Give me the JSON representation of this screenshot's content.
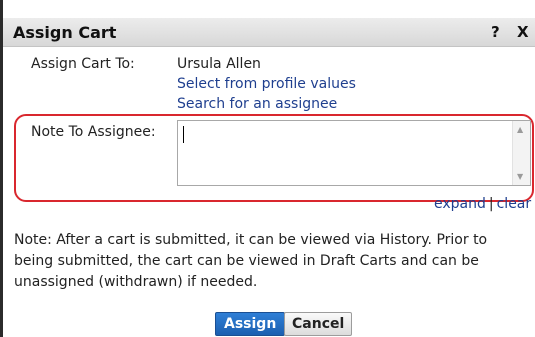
{
  "dialog": {
    "title": "Assign Cart",
    "help_label": "?",
    "close_label": "X"
  },
  "assign_to": {
    "label": "Assign Cart To:",
    "value": "Ursula Allen",
    "link_profile": "Select from profile values",
    "link_search": "Search for an assignee"
  },
  "note": {
    "label": "Note To Assignee:",
    "value": "",
    "expand_label": "expand",
    "separator": "|",
    "clear_label": "clear"
  },
  "info_text": "Note: After a cart is submitted, it can be viewed via History. Prior to being submitted, the cart can be viewed in Draft Carts and can be unassigned (withdrawn) if needed.",
  "buttons": {
    "assign": "Assign",
    "cancel": "Cancel"
  },
  "colors": {
    "link": "#1f3f8f",
    "highlight": "#d9272e",
    "primary_button": "#2f7fd6"
  }
}
